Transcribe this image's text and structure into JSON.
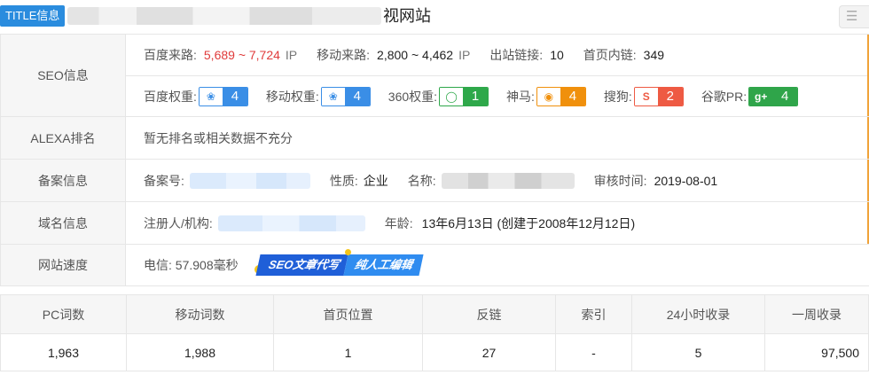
{
  "title_bar": {
    "tag": "TITLE信息",
    "title_suffix": "视网站",
    "corner_icon": "layers-icon"
  },
  "seo": {
    "label": "SEO信息",
    "baidu_traffic_label": "百度来路:",
    "baidu_traffic_value": "5,689 ~ 7,724",
    "baidu_traffic_unit": "IP",
    "mobile_traffic_label": "移动来路:",
    "mobile_traffic_value": "2,800 ~ 4,462",
    "mobile_traffic_unit": "IP",
    "outbound_label": "出站链接:",
    "outbound_value": "10",
    "home_links_label": "首页内链:",
    "home_links_value": "349",
    "weights": [
      {
        "label": "百度权重:",
        "value": "4",
        "icon": "paw-icon",
        "color": "#3a8ee6"
      },
      {
        "label": "移动权重:",
        "value": "4",
        "icon": "paw-icon",
        "color": "#3a8ee6"
      },
      {
        "label": "360权重:",
        "value": "1",
        "icon": "ring-icon",
        "color": "#2ea84a"
      },
      {
        "label": "神马:",
        "value": "4",
        "icon": "owl-icon",
        "color": "#f0900c"
      },
      {
        "label": "搜狗:",
        "value": "2",
        "icon": "sogou-icon",
        "color": "#ee5a43"
      },
      {
        "label": "谷歌PR:",
        "value": "4",
        "icon": "google-plus-icon",
        "color": "#2fa54a"
      }
    ]
  },
  "alexa": {
    "label": "ALEXA排名",
    "value": "暂无排名或相关数据不充分"
  },
  "icp": {
    "label": "备案信息",
    "number_label": "备案号:",
    "nature_label": "性质:",
    "nature_value": "企业",
    "name_label": "名称:",
    "review_label": "审核时间:",
    "review_value": "2019-08-01"
  },
  "domain": {
    "label": "域名信息",
    "registrant_label": "注册人/机构:",
    "age_label": "年龄:",
    "age_value": "13年6月13日 (创建于2008年12月12日)"
  },
  "speed": {
    "label": "网站速度",
    "value": "电信: 57.908毫秒",
    "promo_left": "SEO文章代写",
    "promo_right": "纯人工编辑"
  },
  "stats": {
    "headers": [
      "PC词数",
      "移动词数",
      "首页位置",
      "反链",
      "索引",
      "24小时收录",
      "一周收录"
    ],
    "row": [
      "1,963",
      "1,988",
      "1",
      "27",
      "-",
      "5",
      "97,500"
    ]
  }
}
